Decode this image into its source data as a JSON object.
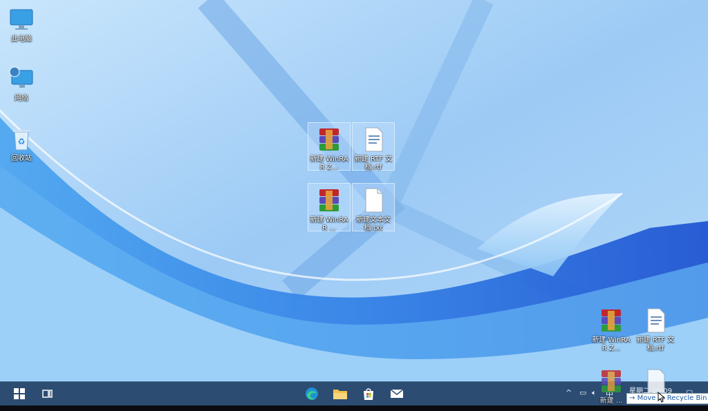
{
  "desktop": {
    "icons_left": [
      {
        "label": "此电脑"
      },
      {
        "label": "网络"
      },
      {
        "label": "回收站"
      }
    ],
    "icons_center": [
      {
        "label": "新建 WinRAR Z..."
      },
      {
        "label": "新建 RTF 文档.rtf"
      },
      {
        "label": "新建 WinRAR ..."
      },
      {
        "label": "新建文本文档.txt"
      }
    ],
    "icons_right": [
      {
        "label": "新建 WinRAR Z..."
      },
      {
        "label": "新建 RTF 文档.rtf"
      }
    ],
    "drag_ghost": {
      "label": "新建 ..."
    }
  },
  "taskbar": {
    "apps": [
      "start",
      "task-view",
      "edge",
      "file-explorer",
      "store",
      "mail"
    ],
    "clock": "星期二 20:09",
    "input_char": "中"
  },
  "drag_tooltip": {
    "arrow": "→",
    "text": "Move to Recycle Bin"
  },
  "colors": {
    "taskbar": "#2c4c72",
    "tooltip_text": "#1a5aa8"
  }
}
